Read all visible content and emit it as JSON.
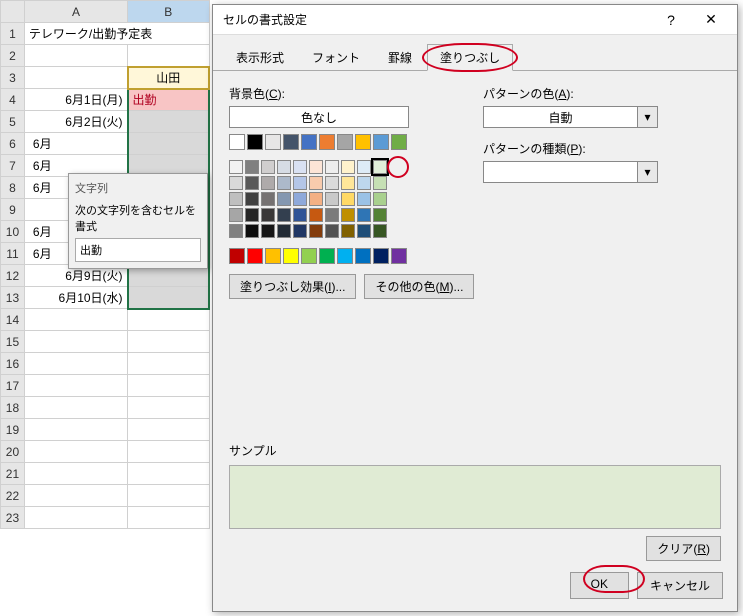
{
  "sheet": {
    "colA": "A",
    "colB": "B",
    "title": "テレワーク/出勤予定表",
    "header_b": "山田",
    "rows": [
      {
        "n": "1"
      },
      {
        "n": "2"
      },
      {
        "n": "3"
      },
      {
        "n": "4",
        "date": "6月1日(月)",
        "val": "出勤"
      },
      {
        "n": "5",
        "date": "6月2日(火)"
      },
      {
        "n": "6",
        "date": "6月"
      },
      {
        "n": "7",
        "date": "6月"
      },
      {
        "n": "8",
        "date": "6月"
      },
      {
        "n": "9",
        "date": ""
      },
      {
        "n": "10",
        "date": "6月"
      },
      {
        "n": "11",
        "date": "6月"
      },
      {
        "n": "12",
        "date": "6月9日(火)"
      },
      {
        "n": "13",
        "date": "6月10日(水)"
      },
      {
        "n": "14"
      },
      {
        "n": "15"
      },
      {
        "n": "16"
      },
      {
        "n": "17"
      },
      {
        "n": "18"
      },
      {
        "n": "19"
      },
      {
        "n": "20"
      },
      {
        "n": "21"
      },
      {
        "n": "22"
      },
      {
        "n": "23"
      }
    ]
  },
  "popup": {
    "title": "文字列",
    "label": "次の文字列を含むセルを書式",
    "value": "出勤"
  },
  "dialog": {
    "title": "セルの書式設定",
    "help": "?",
    "close": "✕",
    "tabs": {
      "format": "表示形式",
      "font": "フォント",
      "border": "罫線",
      "fill": "塗りつぶし"
    },
    "bg_label": "背景色(",
    "bg_label_u": "C",
    "bg_label_end": "):",
    "no_color": "色なし",
    "pattern_color_label": "パターンの色(",
    "pattern_color_u": "A",
    "pattern_color_end": "):",
    "pattern_color_value": "自動",
    "pattern_type_label": "パターンの種類(",
    "pattern_type_u": "P",
    "pattern_type_end": "):",
    "fill_effects": "塗りつぶし効果(",
    "fill_effects_u": "I",
    "fill_effects_end": ")...",
    "more_colors": "その他の色(",
    "more_colors_u": "M",
    "more_colors_end": ")...",
    "sample": "サンプル",
    "clear": "クリア(",
    "clear_u": "R",
    "clear_end": ")",
    "ok": "OK",
    "cancel": "キャンセル",
    "theme_row": [
      "#ffffff",
      "#000000",
      "#e7e6e6",
      "#44546a",
      "#4472c4",
      "#ed7d31",
      "#a5a5a5",
      "#ffc000",
      "#5b9bd5",
      "#70ad47"
    ],
    "tints": [
      [
        "#f2f2f2",
        "#808080",
        "#d0cece",
        "#d6dce4",
        "#d9e1f2",
        "#fce4d6",
        "#ededed",
        "#fff2cc",
        "#ddebf7",
        "#e2efda"
      ],
      [
        "#d9d9d9",
        "#595959",
        "#aeaaaa",
        "#acb9ca",
        "#b4c6e7",
        "#f8cbad",
        "#dbdbdb",
        "#ffe699",
        "#bdd7ee",
        "#c6e0b4"
      ],
      [
        "#bfbfbf",
        "#404040",
        "#757171",
        "#8497b0",
        "#8ea9db",
        "#f4b084",
        "#c9c9c9",
        "#ffd966",
        "#9bc2e6",
        "#a9d08e"
      ],
      [
        "#a6a6a6",
        "#262626",
        "#3a3838",
        "#333f4f",
        "#305496",
        "#c65911",
        "#7b7b7b",
        "#bf8f00",
        "#2f75b5",
        "#548235"
      ],
      [
        "#808080",
        "#0d0d0d",
        "#161616",
        "#222b35",
        "#203764",
        "#833c0c",
        "#525252",
        "#806000",
        "#1f4e78",
        "#375623"
      ]
    ],
    "standard": [
      "#c00000",
      "#ff0000",
      "#ffc000",
      "#ffff00",
      "#92d050",
      "#00b050",
      "#00b0f0",
      "#0070c0",
      "#002060",
      "#7030a0"
    ],
    "selected_color": "#e2efda"
  }
}
